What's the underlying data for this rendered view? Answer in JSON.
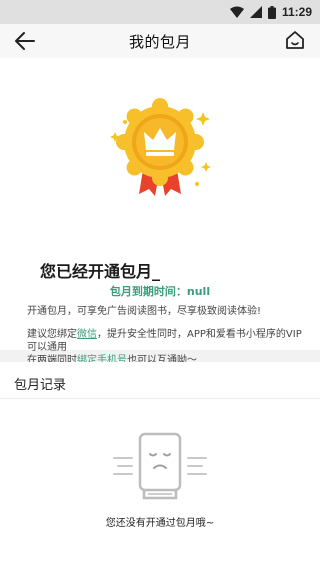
{
  "status_bar": {
    "time": "11:29"
  },
  "header": {
    "title": "我的包月"
  },
  "membership": {
    "status_text": "您已经开通包月_",
    "expire_label": "包月到期时间：null",
    "description": "开通包月，可享免广告阅读图书，尽享极致阅读体验!",
    "tip_part1": "建议您绑定",
    "tip_link_wechat": "微信",
    "tip_part2": "，提升安全性同时，APP和爱看书小程序的VIP可以通用",
    "tip_part3": "在两端同时",
    "tip_link_phone": "绑定手机号",
    "tip_part4": "也可以互通呦～"
  },
  "records": {
    "title": "包月记录",
    "empty_text": "您还没有开通过包月哦~"
  },
  "colors": {
    "accent": "#3a9e7a",
    "medal_gold": "#f5b51f",
    "ribbon_red": "#e8412c"
  }
}
